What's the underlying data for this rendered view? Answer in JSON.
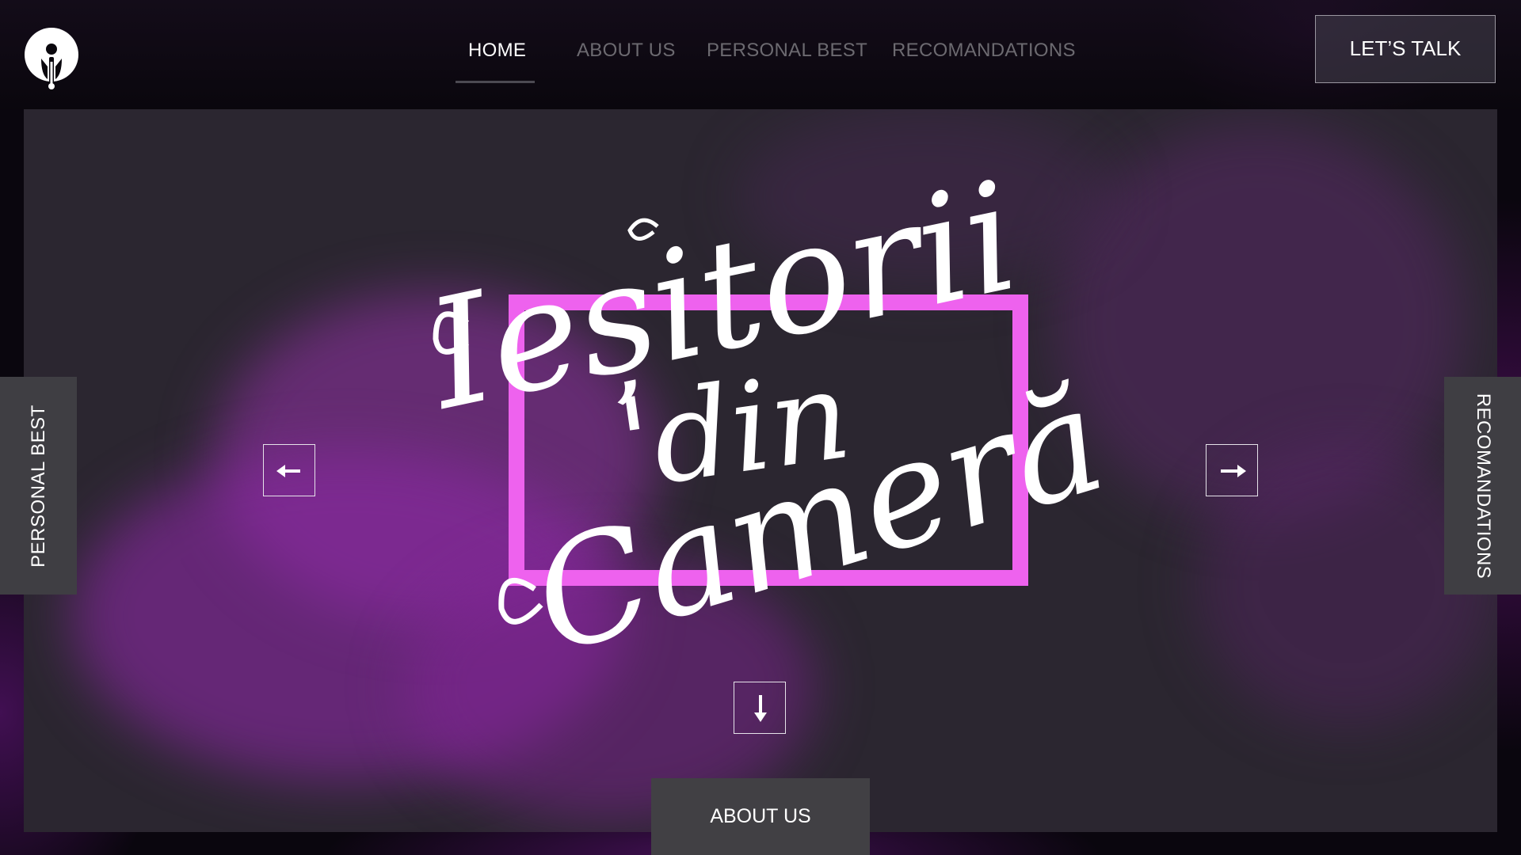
{
  "header": {
    "logo_icon": "info-pin-logo-icon",
    "nav": [
      {
        "label": "HOME",
        "active": true
      },
      {
        "label": "ABOUT US",
        "active": false
      },
      {
        "label": "PERSONAL BEST",
        "active": false
      },
      {
        "label": "RECOMANDATIONS",
        "active": false
      }
    ],
    "cta_label": "LET’S TALK"
  },
  "hero": {
    "title_lines": [
      "Ieșitorii",
      "'din",
      "Cameră"
    ],
    "accent_color": "#ee62ee",
    "prev_icon": "arrow-left-icon",
    "next_icon": "arrow-right-icon",
    "down_icon": "arrow-down-icon"
  },
  "side_tabs": {
    "left_label": "PERSONAL BEST",
    "right_label": "RECOMANDATIONS"
  },
  "bottom_tab": {
    "label": "ABOUT US"
  }
}
